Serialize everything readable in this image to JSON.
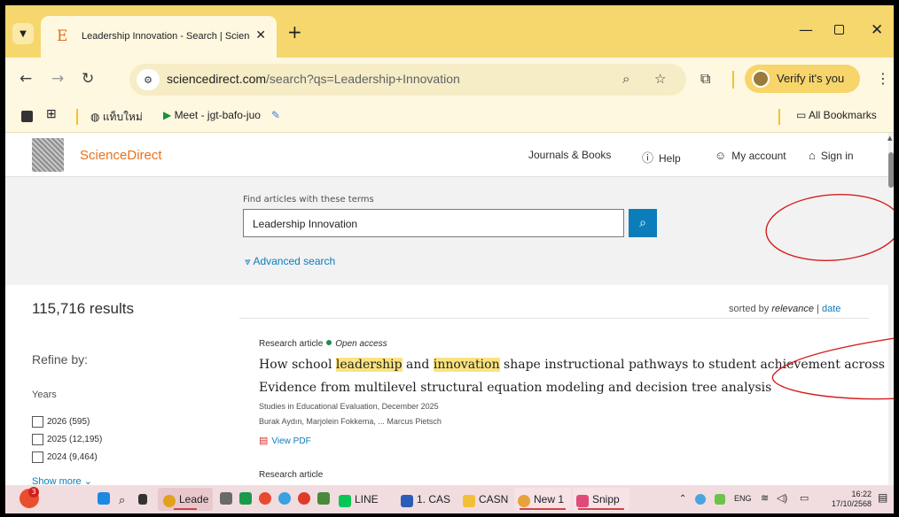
{
  "browser": {
    "tab_title": "Leadership Innovation - Search | ScienceDirect.com",
    "favicon_letter": "E",
    "new_tab": "+",
    "url_host": "sciencedirect.com",
    "url_rest": "/search?qs=Leadership+Innovation",
    "verify_label": "Verify it's you",
    "icons": [
      "chevron-down-icon",
      "close-icon",
      "back-icon",
      "forward-icon",
      "reload-icon",
      "site-info-icon",
      "zoom-icon",
      "star-icon",
      "extensions-icon",
      "kebab-icon",
      "minimize-icon",
      "maximize-icon"
    ]
  },
  "bookmarks": {
    "items": [
      {
        "label": "แท็บใหม่"
      },
      {
        "label": "Meet - jgt-bafo-juo"
      }
    ],
    "all_bookmarks": "All Bookmarks"
  },
  "site": {
    "brand": "ScienceDirect",
    "nav": [
      {
        "label": "Journals & Books",
        "icon": ""
      },
      {
        "label": "Help",
        "icon": "help-icon"
      },
      {
        "label": "My account",
        "icon": "person-icon"
      },
      {
        "label": "Sign in",
        "icon": "institution-icon"
      }
    ]
  },
  "search": {
    "label": "Find articles with these terms",
    "value": "Leadership Innovation",
    "advanced": "Advanced search"
  },
  "results": {
    "count": "115,716 results",
    "sorted_prefix": "sorted by",
    "sort_relevance": "relevance",
    "sort_sep": "|",
    "sort_date": "date"
  },
  "refine": {
    "title": "Refine by:",
    "years_label": "Years",
    "years": [
      {
        "label": "2026 (595)"
      },
      {
        "label": "2025 (12,195)"
      },
      {
        "label": "2024 (9,464)"
      }
    ],
    "show_more": "Show more"
  },
  "articles": [
    {
      "type": "Research article",
      "access": "Open access",
      "title_line1_pre": "How school ",
      "title_hl1": "leadership",
      "title_mid": " and ",
      "title_hl2": "innovation",
      "title_line1_post": " shape instructional pathways to student achievement across nations:",
      "title_line2": "Evidence from multilevel structural equation modeling and decision tree analysis",
      "journal": "Studies in Educational Evaluation, December 2025",
      "authors": "Burak Aydın, Marjolein Fokkema, ... Marcus Pietsch",
      "pdf": "View PDF"
    },
    {
      "type": "Research article"
    }
  ],
  "taskbar": {
    "items": [
      {
        "label": "Leade"
      },
      {
        "label": "LINE"
      },
      {
        "label": "1. CAS"
      },
      {
        "label": "CASN"
      },
      {
        "label": "New 1"
      },
      {
        "label": "Snipp"
      }
    ],
    "lang": "ENG",
    "time": "16:22",
    "date": "17/10/2568",
    "notifications": "3"
  },
  "colors": {
    "tabstrip": "#f5d76e",
    "accent": "#0c7dbb",
    "brand": "#e9711c",
    "highlight": "#fbe37f",
    "annotation": "#d61f1f"
  }
}
